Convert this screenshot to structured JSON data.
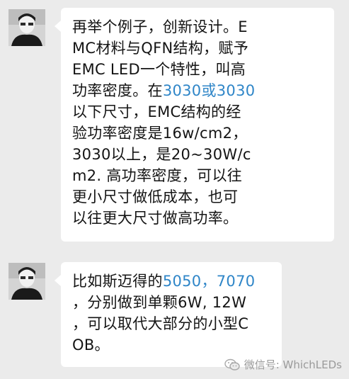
{
  "messages": [
    {
      "lines": [
        [
          {
            "t": "再举个例子，创新设计。E"
          }
        ],
        [
          {
            "t": "MC材料与QFN结构，赋予"
          }
        ],
        [
          {
            "t": "EMC LED一个特性，叫高"
          }
        ],
        [
          {
            "t": "功率密度。在"
          },
          {
            "t": "3030或3030",
            "link": true
          }
        ],
        [
          {
            "t": "以下尺寸，EMC结构的经"
          }
        ],
        [
          {
            "t": "验功率密度是16w/cm2，"
          }
        ],
        [
          {
            "t": "3030以上，是20~30W/c"
          }
        ],
        [
          {
            "t": "m2. 高功率密度，可以往"
          }
        ],
        [
          {
            "t": "更小尺寸做低成本，也可"
          }
        ],
        [
          {
            "t": "以往更大尺寸做高功率。"
          }
        ]
      ]
    },
    {
      "lines": [
        [
          {
            "t": "比如斯迈得的"
          },
          {
            "t": "5050，7070",
            "link": true
          }
        ],
        [
          {
            "t": "，分别做到单颗6W, 12W"
          }
        ],
        [
          {
            "t": "，可以取代大部分的小型C"
          }
        ],
        [
          {
            "t": "OB。"
          }
        ]
      ]
    }
  ],
  "watermark": {
    "text": "微信号: WhichLEDs",
    "icon": "wechat-icon"
  },
  "colors": {
    "background": "#ebebeb",
    "bubble": "#ffffff",
    "text": "#141414",
    "link": "#2f86c8",
    "watermark": "#9a9a9a"
  }
}
